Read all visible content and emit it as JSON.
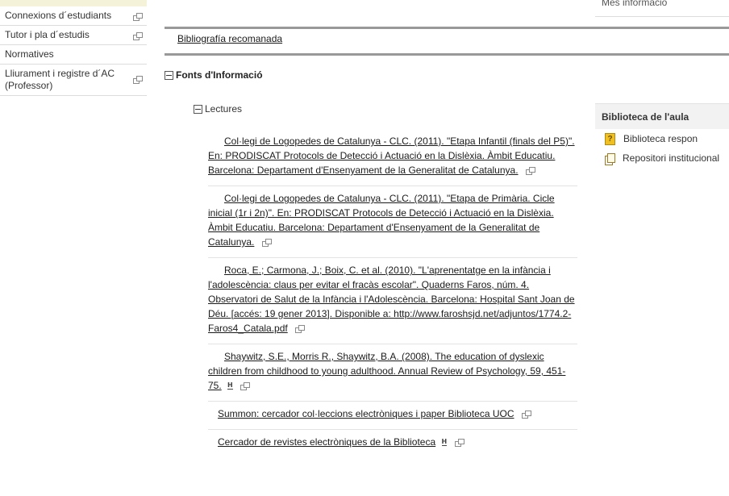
{
  "sidebar": {
    "items": [
      {
        "label": "Connexions d´estudiants"
      },
      {
        "label": "Tutor i pla d´estudis"
      },
      {
        "label": "Normatives"
      },
      {
        "label": "Lliurament i registre d´AC (Professor)"
      }
    ]
  },
  "top_right": {
    "label": "Més informació"
  },
  "bibliografia": {
    "label": "Bibliografía recomanada"
  },
  "fonts": {
    "heading": "Fonts d'Informació"
  },
  "lectures": {
    "heading": "Lectures",
    "references": [
      {
        "text": "Col·legi de Logopedes de Catalunya - CLC. (2011). \"Etapa Infantil (finals del P5)\". En: PRODISCAT Protocols de Detecció i Actuació en la Dislèxia. Àmbit Educatiu. Barcelona: Departament d'Ensenyament de la Generalitat de Catalunya."
      },
      {
        "text": "Col·legi de Logopedes de Catalunya - CLC. (2011). \"Etapa de Primària. Cicle inicial (1r i 2n)\". En: PRODISCAT Protocols de Detecció i Actuació en la Dislèxia. Àmbit Educatiu. Barcelona: Departament d'Ensenyament de la Generalitat de Catalunya."
      },
      {
        "text": "Roca, E.; Carmona, J.; Boix, C. et al. (2010). \"L'aprenentatge en la infància i l'adolescència: claus per evitar el fracàs escolar\". Quaderns Faros, núm. 4. Observatori de Salut de la Infància i l'Adolescència. Barcelona: Hospital Sant Joan de Déu. [accés: 19 gener 2013]. Disponible a: http://www.faroshsjd.net/adjuntos/1774.2-Faros4_Catala.pdf"
      },
      {
        "text": "Shaywitz, S.E., Morris R., Shaywitz, B.A. (2008). The education of dyslexic children from childhood to young adulthood. Annual Review of Psychology, 59, 451-75."
      },
      {
        "text": "Summon: cercador col·leccions electròniques i paper Biblioteca UOC"
      },
      {
        "text": "Cercador de revistes electròniques de la Biblioteca"
      }
    ]
  },
  "panel": {
    "title": "Biblioteca de l'aula",
    "items": [
      {
        "label": "Biblioteca respon",
        "icon": "question-icon"
      },
      {
        "label": "Repositori institucional",
        "icon": "documents-icon"
      }
    ]
  }
}
